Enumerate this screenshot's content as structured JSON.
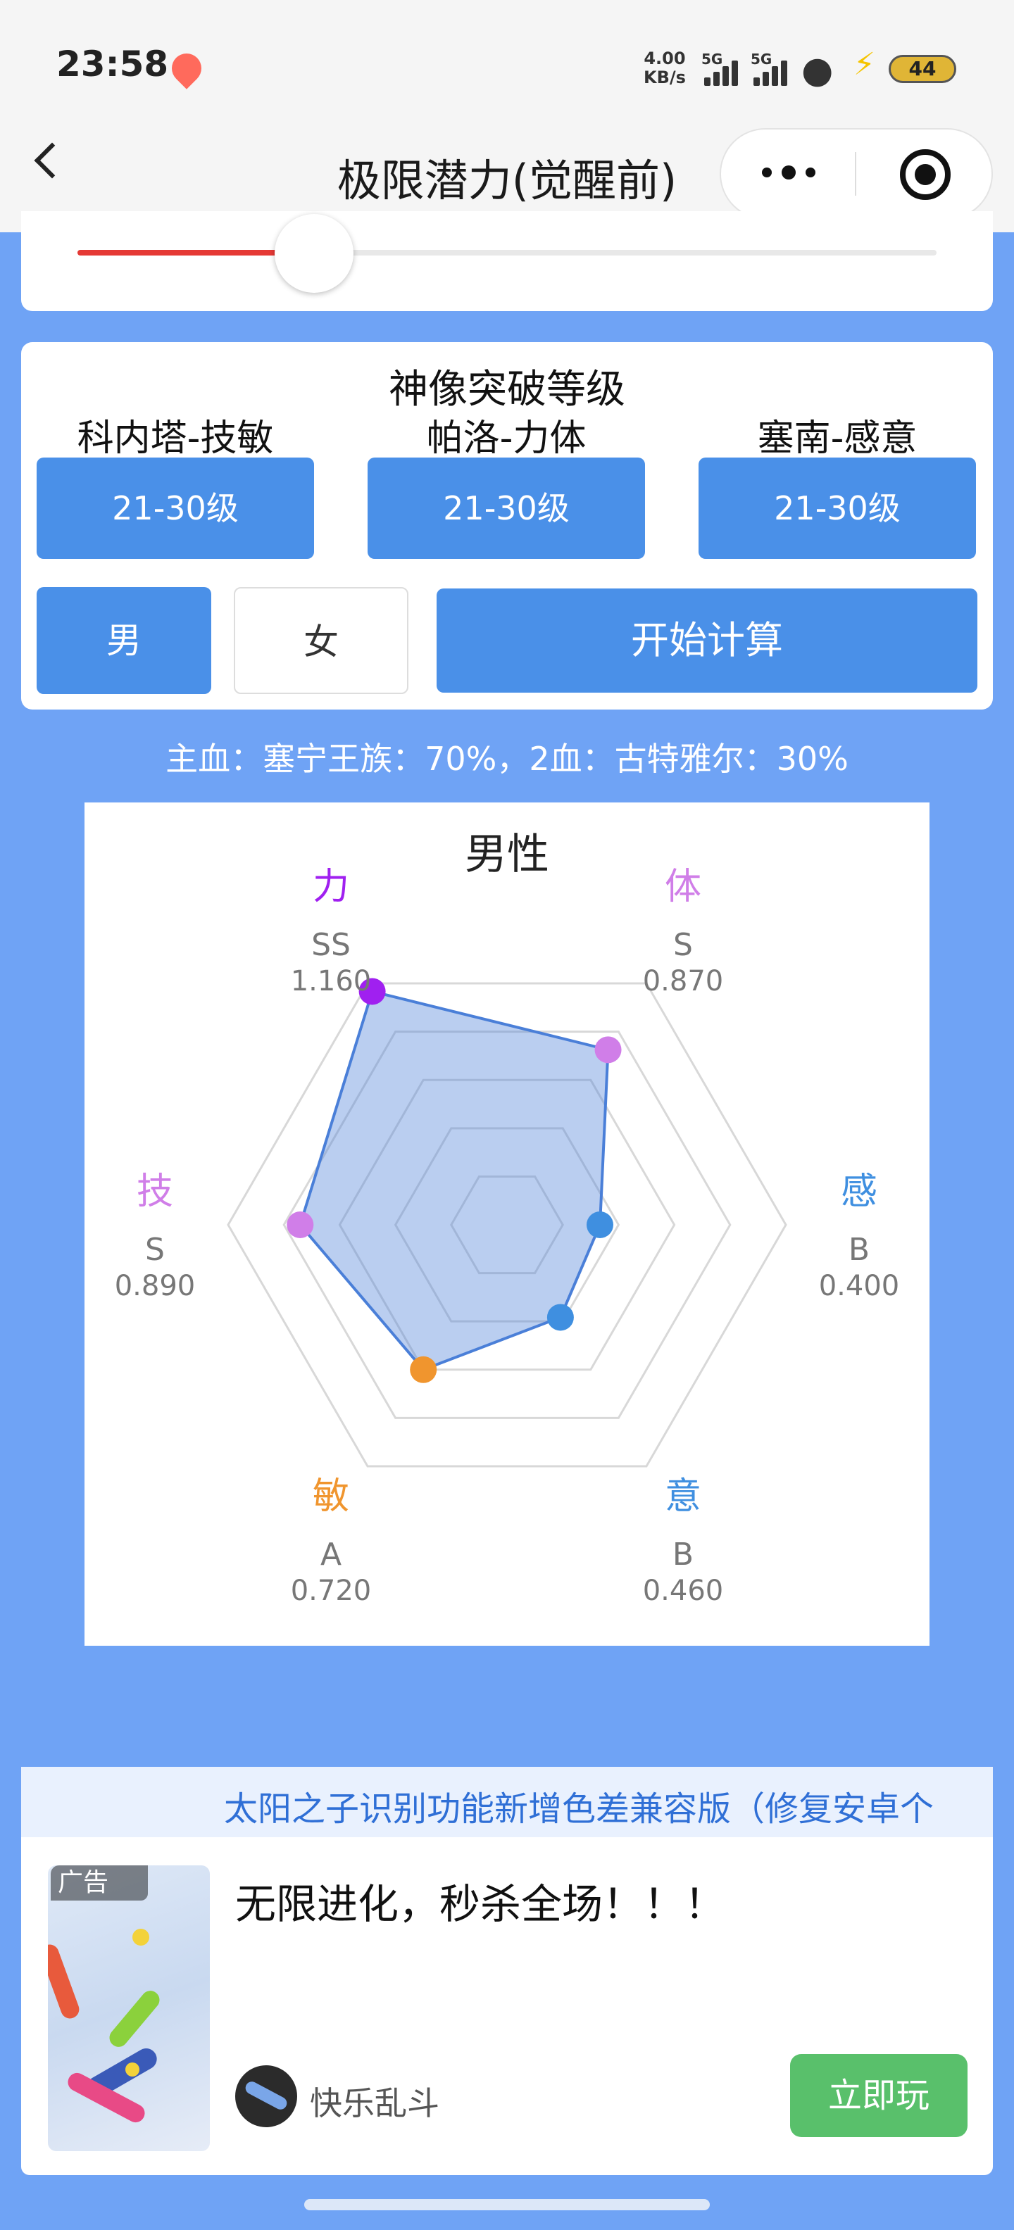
{
  "status_bar": {
    "time": "23:58",
    "speed_value": "4.00",
    "speed_unit": "KB/s",
    "signal_1_label": "5G",
    "signal_2_label": "5G",
    "battery": "44"
  },
  "nav": {
    "title": "极限潜力(觉醒前)"
  },
  "slider": {
    "value_fraction": 0.28,
    "fill_color": "#e53935"
  },
  "settings": {
    "section_title": "神像突破等级",
    "columns": [
      {
        "label": "科内塔-技敏",
        "level": "21-30级"
      },
      {
        "label": "帕洛-力体",
        "level": "21-30级"
      },
      {
        "label": "塞南-感意",
        "level": "21-30级"
      }
    ],
    "gender_male": "男",
    "gender_female": "女",
    "selected_gender": "男",
    "start_button": "开始计算",
    "accent_color": "#4a90e8"
  },
  "bloodline_text": "主血：塞宁王族：70%，2血：古特雅尔：30%",
  "chart_data": {
    "type": "radar",
    "title": "男性",
    "max_value": 1.2,
    "rings": 5,
    "axes": [
      {
        "name": "力",
        "grade": "SS",
        "value": 1.16,
        "value_label": "1.160",
        "color": "#a020f0"
      },
      {
        "name": "体",
        "grade": "S",
        "value": 0.87,
        "value_label": "0.870",
        "color": "#d07ee8"
      },
      {
        "name": "感",
        "grade": "B",
        "value": 0.4,
        "value_label": "0.400",
        "color": "#3f8fe0"
      },
      {
        "name": "意",
        "grade": "B",
        "value": 0.46,
        "value_label": "0.460",
        "color": "#3f8fe0"
      },
      {
        "name": "敏",
        "grade": "A",
        "value": 0.72,
        "value_label": "0.720",
        "color": "#f0952e"
      },
      {
        "name": "技",
        "grade": "S",
        "value": 0.89,
        "value_label": "0.890",
        "color": "#d07ee8"
      }
    ],
    "fill_color": "#4a7fd8",
    "grid": true
  },
  "notice": {
    "text": "太阳之子识别功能新增色差兼容版（修复安卓个"
  },
  "ad": {
    "badge": "广告",
    "headline": "无限进化，秒杀全场！！！",
    "brand": "快乐乱斗",
    "cta": "立即玩"
  }
}
